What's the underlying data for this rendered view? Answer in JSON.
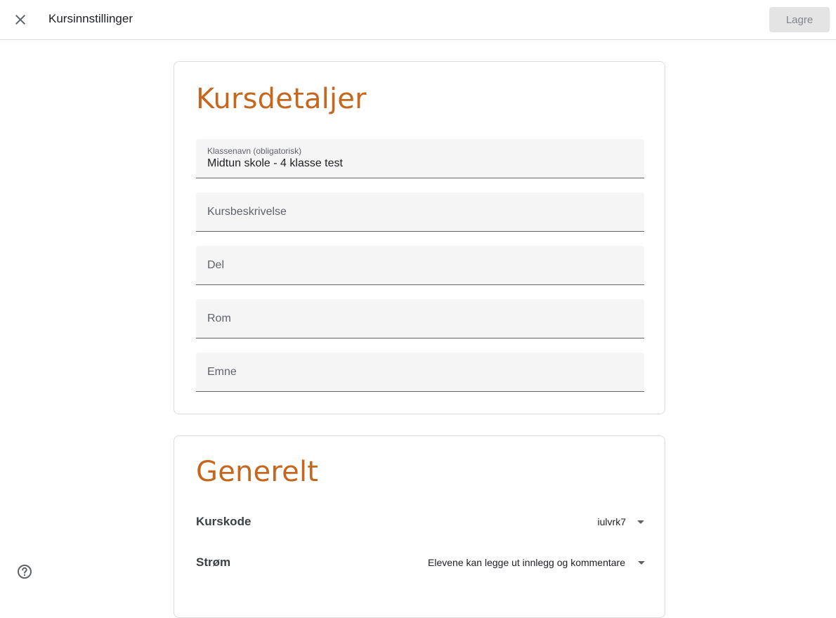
{
  "header": {
    "close_icon": "close-icon",
    "title": "Kursinnstillinger",
    "save_label": "Lagre"
  },
  "details": {
    "heading": "Kursdetaljer",
    "class_name": {
      "label": "Klassenavn (obligatorisk)",
      "value": "Midtun skole - 4 klasse test"
    },
    "description": {
      "label": "Kursbeskrivelse"
    },
    "section": {
      "label": "Del"
    },
    "room": {
      "label": "Rom"
    },
    "subject": {
      "label": "Emne"
    }
  },
  "general": {
    "heading": "Generelt",
    "course_code": {
      "label": "Kurskode",
      "value": "iulvrk7"
    },
    "stream": {
      "label": "Strøm",
      "value": "Elevene kan legge ut innlegg og kommentare"
    }
  },
  "help_icon": "help-circle-icon",
  "colors": {
    "heading_accent": "#c5671f",
    "save_disabled_bg": "#e4e4e5",
    "field_bg": "#f5f5f6"
  }
}
